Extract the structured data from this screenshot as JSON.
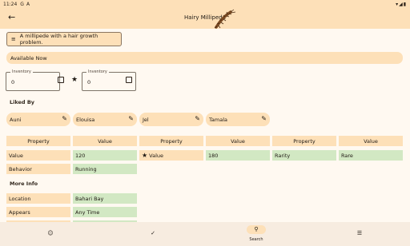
{
  "status": {
    "time": "11:24",
    "icons_left": [
      "G",
      "A"
    ],
    "right": "▾◢▮"
  },
  "appbar": {
    "title": "Hairy Millipede"
  },
  "description": "A millipede with a hair growth problem.",
  "availability": "Available Now",
  "inventory": [
    {
      "label": "Inventory",
      "value": "0"
    },
    {
      "label": "Inventory",
      "value": "0"
    }
  ],
  "liked_by": {
    "heading": "Liked By",
    "villagers": [
      "Auni",
      "Elouisa",
      "Jel",
      "Tamala"
    ]
  },
  "tables": {
    "t1": {
      "headers": [
        "Property",
        "Value"
      ],
      "rows": [
        [
          "Value",
          "120"
        ],
        [
          "Behavior",
          "Running"
        ]
      ]
    },
    "t2": {
      "headers": [
        "Property",
        "Value"
      ],
      "rows": [
        [
          "Value",
          "180"
        ]
      ]
    },
    "t3": {
      "headers": [
        "Property",
        "Value"
      ],
      "rows": [
        [
          "Rarity",
          "Rare"
        ]
      ]
    }
  },
  "more_info": {
    "heading": "More Info",
    "rows": [
      [
        "Location",
        "Bahari Bay"
      ],
      [
        "Appears",
        "Any Time"
      ]
    ]
  },
  "nav": {
    "search_label": "Search"
  },
  "colors": {
    "accent": "#fde0b8",
    "value_green": "#d2e8c3",
    "background": "#fff9f1"
  },
  "icons": [
    "back-arrow-icon",
    "millipede-icon",
    "notes-icon",
    "edit-check-icon",
    "star-icon",
    "person-icon",
    "check-icon",
    "search-icon",
    "list-icon"
  ]
}
